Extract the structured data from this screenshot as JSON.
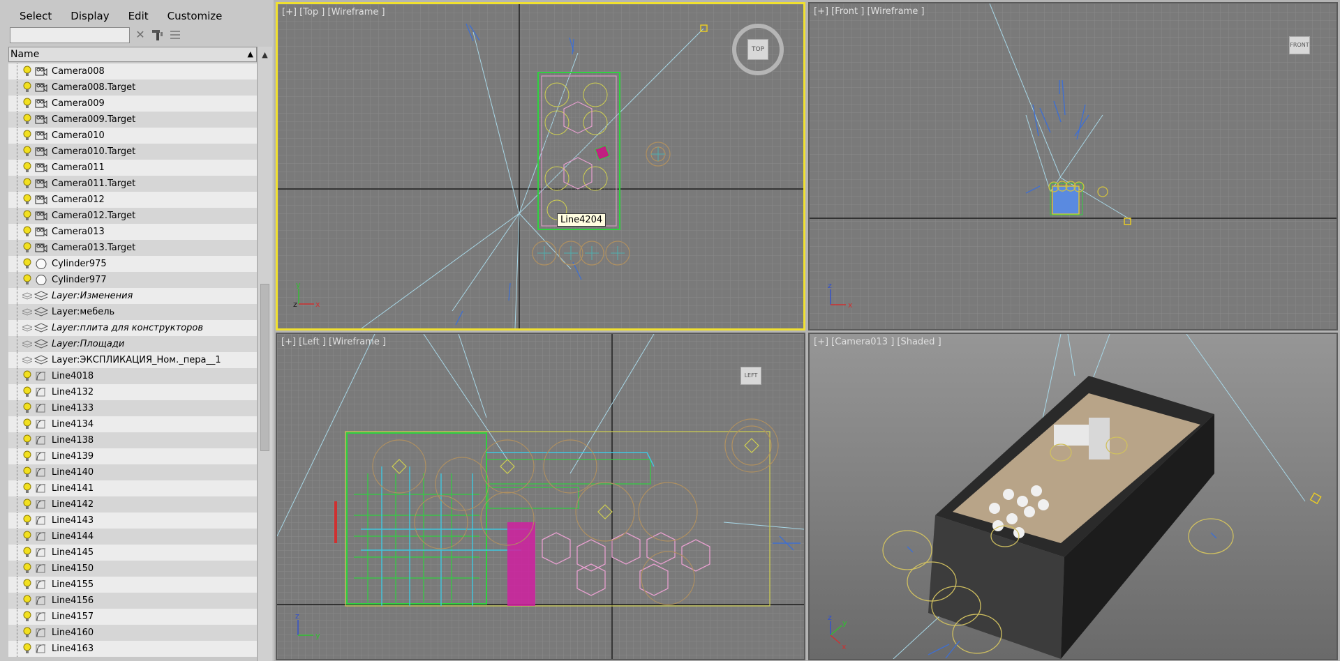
{
  "menu": [
    "Select",
    "Display",
    "Edit",
    "Customize"
  ],
  "search": {
    "value": ""
  },
  "toolbar_icons": [
    "clear-icon",
    "filter-icon",
    "options-icon"
  ],
  "explorer": {
    "column_header": "Name",
    "rows": [
      {
        "label": "Camera008",
        "type": "camera"
      },
      {
        "label": "Camera008.Target",
        "type": "camera"
      },
      {
        "label": "Camera009",
        "type": "camera"
      },
      {
        "label": "Camera009.Target",
        "type": "camera"
      },
      {
        "label": "Camera010",
        "type": "camera"
      },
      {
        "label": "Camera010.Target",
        "type": "camera"
      },
      {
        "label": "Camera011",
        "type": "camera"
      },
      {
        "label": "Camera011.Target",
        "type": "camera"
      },
      {
        "label": "Camera012",
        "type": "camera"
      },
      {
        "label": "Camera012.Target",
        "type": "camera"
      },
      {
        "label": "Camera013",
        "type": "camera"
      },
      {
        "label": "Camera013.Target",
        "type": "camera"
      },
      {
        "label": "Cylinder975",
        "type": "geometry"
      },
      {
        "label": "Cylinder977",
        "type": "geometry"
      },
      {
        "label": "Layer:Изменения",
        "type": "layer",
        "italic": true
      },
      {
        "label": "Layer:мебель",
        "type": "layer"
      },
      {
        "label": "Layer:плита для конструкторов",
        "type": "layer",
        "italic": true
      },
      {
        "label": "Layer:Площади",
        "type": "layer",
        "italic": true
      },
      {
        "label": "Layer:ЭКСПЛИКАЦИЯ_Ном._пера__1",
        "type": "layer"
      },
      {
        "label": "Line4018",
        "type": "shape"
      },
      {
        "label": "Line4132",
        "type": "shape"
      },
      {
        "label": "Line4133",
        "type": "shape"
      },
      {
        "label": "Line4134",
        "type": "shape"
      },
      {
        "label": "Line4138",
        "type": "shape"
      },
      {
        "label": "Line4139",
        "type": "shape"
      },
      {
        "label": "Line4140",
        "type": "shape"
      },
      {
        "label": "Line4141",
        "type": "shape"
      },
      {
        "label": "Line4142",
        "type": "shape"
      },
      {
        "label": "Line4143",
        "type": "shape"
      },
      {
        "label": "Line4144",
        "type": "shape"
      },
      {
        "label": "Line4145",
        "type": "shape"
      },
      {
        "label": "Line4150",
        "type": "shape"
      },
      {
        "label": "Line4155",
        "type": "shape"
      },
      {
        "label": "Line4156",
        "type": "shape"
      },
      {
        "label": "Line4157",
        "type": "shape"
      },
      {
        "label": "Line4160",
        "type": "shape"
      },
      {
        "label": "Line4163",
        "type": "shape"
      }
    ]
  },
  "viewports": {
    "top": {
      "label": "[+] [Top ] [Wireframe ]",
      "navcube": "TOP",
      "axis": [
        "y",
        "z",
        "x"
      ]
    },
    "front": {
      "label": "[+] [Front ] [Wireframe ]",
      "navcube": "FRONT",
      "axis": [
        "z",
        "x"
      ]
    },
    "left": {
      "label": "[+] [Left ] [Wireframe ]",
      "navcube": "LEFT",
      "axis": [
        "z",
        "y"
      ]
    },
    "camera": {
      "label": "[+] [Camera013 ] [Shaded ]",
      "axis": [
        "z",
        "y",
        "x"
      ]
    }
  },
  "tooltip": "Line4204",
  "colors": {
    "active_border": "#f0e030",
    "viewport_bg": "#7a7a7a",
    "grid": "#8a8a8a"
  }
}
